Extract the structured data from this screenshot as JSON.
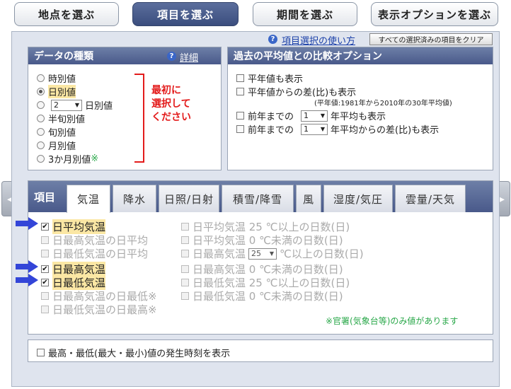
{
  "nav": {
    "buttons": [
      {
        "label": "地点を選ぶ"
      },
      {
        "label": "項目を選ぶ"
      },
      {
        "label": "期間を選ぶ"
      },
      {
        "label": "表示オプションを選ぶ"
      }
    ]
  },
  "help": {
    "link": "項目選択の使い方",
    "clear_button": "すべての選択済みの項目をクリア"
  },
  "data_type": {
    "title": "データの種類",
    "detail_link": "詳細",
    "options": [
      {
        "label": "時別値"
      },
      {
        "label": "日別値"
      },
      {
        "label": "日別値",
        "select_value": "2"
      },
      {
        "label": "半旬別値"
      },
      {
        "label": "旬別値"
      },
      {
        "label": "月別値"
      },
      {
        "label": "3か月別値",
        "mark": "※"
      }
    ],
    "instruction_line1": "最初に",
    "instruction_line2": "選択して",
    "instruction_line3": "ください"
  },
  "compare": {
    "title": "過去の平均値との比較オプション",
    "show_normal": "平年値も表示",
    "show_diff": "平年値からの差(比)も表示",
    "normal_note": "(平年値:1981年から2010年の30年平均値)",
    "prev_avg_prefix": "前年までの",
    "prev_avg_value": "1",
    "prev_avg_suffix": "年平均も表示",
    "prev_diff_prefix": "前年までの",
    "prev_diff_value": "1",
    "prev_diff_suffix": "年平均からの差(比)も表示"
  },
  "items": {
    "label": "項目",
    "tabs": [
      {
        "label": "気温"
      },
      {
        "label": "降水"
      },
      {
        "label": "日照/日射"
      },
      {
        "label": "積雪/降雪"
      },
      {
        "label": "風"
      },
      {
        "label": "湿度/気圧"
      },
      {
        "label": "雲量/天気"
      }
    ],
    "left_col": [
      {
        "label": "日平均気温"
      },
      {
        "label": "日最高気温の日平均"
      },
      {
        "label": "日最低気温の日平均"
      },
      {
        "label": "日最高気温"
      },
      {
        "label": "日最低気温"
      },
      {
        "label": "日最高気温の日最低※"
      },
      {
        "label": "日最低気温の日最高※"
      }
    ],
    "right_col": [
      {
        "label": "日平均気温 25 ℃以上の日数(日)"
      },
      {
        "label": "日平均気温 0 ℃未満の日数(日)"
      },
      {
        "prefix": "日最高気温",
        "select_value": "25",
        "suffix": "℃以上の日数(日)"
      },
      {
        "label": "日最高気温 0 ℃未満の日数(日)"
      },
      {
        "label": "日最低気温 25 ℃以上の日数(日)"
      },
      {
        "label": "日最低気温 0 ℃未満の日数(日)"
      }
    ],
    "note": "※官署(気象台等)のみ値があります"
  },
  "footer": {
    "label": "最高・最低(最大・最小)値の発生時刻を表示"
  },
  "icons": {
    "help": "question-circle-icon",
    "prev": "left-arrow-icon",
    "next": "right-arrow-icon",
    "pointer": "blue-arrow-icon"
  }
}
